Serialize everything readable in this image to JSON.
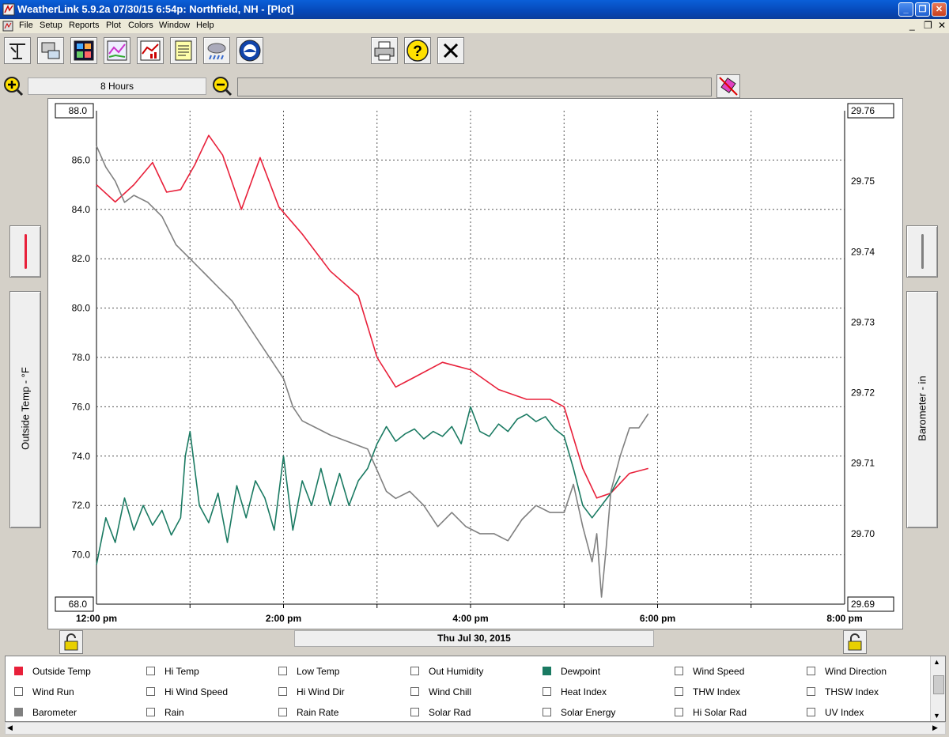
{
  "window": {
    "title": "WeatherLink 5.9.2a  07/30/15   6:54p: Northfield, NH - [Plot]"
  },
  "menu": [
    "File",
    "Setup",
    "Reports",
    "Plot",
    "Colors",
    "Window",
    "Help"
  ],
  "toolbar": {
    "icons": [
      "station-icon",
      "download-icon",
      "bulletin-icon",
      "strip-chart-icon",
      "plot-icon",
      "browse-icon",
      "forecast-icon",
      "noaa-icon",
      "print-icon",
      "help-icon",
      "close-icon"
    ]
  },
  "range": {
    "zoom_in": "+",
    "span": "8 Hours",
    "zoom_out": "−",
    "status": ""
  },
  "left_axis": {
    "label": "Outside Temp - °F",
    "ticks": [
      "88.0",
      "86.0",
      "84.0",
      "82.0",
      "80.0",
      "78.0",
      "76.0",
      "74.0",
      "72.0",
      "70.0",
      "68.0"
    ]
  },
  "right_axis": {
    "label": "Barometer - in",
    "ticks": [
      "29.76",
      "29.75",
      "29.74",
      "29.73",
      "29.72",
      "29.71",
      "29.70",
      "29.69"
    ]
  },
  "x_axis": {
    "ticks": [
      "12:00 pm",
      "2:00 pm",
      "4:00 pm",
      "6:00 pm",
      "8:00 pm"
    ],
    "date": "Thu Jul 30, 2015"
  },
  "legend": [
    {
      "label": "Outside Temp",
      "color": "#e8203a",
      "checked": true
    },
    {
      "label": "Hi Temp",
      "checked": false
    },
    {
      "label": "Low Temp",
      "checked": false
    },
    {
      "label": "Out Humidity",
      "checked": false
    },
    {
      "label": "Dewpoint",
      "color": "#1a7a62",
      "checked": true
    },
    {
      "label": "Wind Speed",
      "checked": false
    },
    {
      "label": "Wind Direction",
      "checked": false
    },
    {
      "label": "Wind Run",
      "checked": false
    },
    {
      "label": "Hi Wind Speed",
      "checked": false
    },
    {
      "label": "Hi Wind Dir",
      "checked": false
    },
    {
      "label": "Wind Chill",
      "checked": false
    },
    {
      "label": "Heat Index",
      "checked": false
    },
    {
      "label": "THW Index",
      "checked": false
    },
    {
      "label": "THSW Index",
      "checked": false
    },
    {
      "label": "Barometer",
      "color": "#808080",
      "checked": true
    },
    {
      "label": "Rain",
      "checked": false
    },
    {
      "label": "Rain Rate",
      "checked": false
    },
    {
      "label": "Solar Rad",
      "checked": false
    },
    {
      "label": "Solar Energy",
      "checked": false
    },
    {
      "label": "Hi Solar Rad",
      "checked": false
    },
    {
      "label": "UV Index",
      "checked": false
    }
  ],
  "chart_data": {
    "type": "line",
    "x_unit": "hours after 12:00 pm",
    "xlim": [
      0,
      8
    ],
    "ylim_left": [
      68,
      88
    ],
    "ylim_right": [
      29.69,
      29.76
    ],
    "grid": true,
    "series": [
      {
        "name": "Outside Temp",
        "axis": "left",
        "color": "#e8203a",
        "x": [
          0,
          0.2,
          0.4,
          0.6,
          0.75,
          0.9,
          1.05,
          1.2,
          1.35,
          1.55,
          1.75,
          1.95,
          2.2,
          2.5,
          2.8,
          3.0,
          3.2,
          3.4,
          3.7,
          4.0,
          4.3,
          4.6,
          4.85,
          5.0,
          5.2,
          5.35,
          5.5,
          5.7,
          5.9
        ],
        "y": [
          85.0,
          84.3,
          85.0,
          85.9,
          84.7,
          84.8,
          85.8,
          87.0,
          86.2,
          84.0,
          86.1,
          84.1,
          83.0,
          81.5,
          80.5,
          78.0,
          76.8,
          77.2,
          77.8,
          77.5,
          76.7,
          76.3,
          76.3,
          76.0,
          73.5,
          72.3,
          72.5,
          73.3,
          73.5
        ]
      },
      {
        "name": "Dewpoint",
        "axis": "left",
        "color": "#1a7a62",
        "x": [
          0,
          0.1,
          0.2,
          0.3,
          0.4,
          0.5,
          0.6,
          0.7,
          0.8,
          0.9,
          0.95,
          1.0,
          1.1,
          1.2,
          1.3,
          1.4,
          1.5,
          1.6,
          1.7,
          1.8,
          1.9,
          2.0,
          2.1,
          2.2,
          2.3,
          2.4,
          2.5,
          2.6,
          2.7,
          2.8,
          2.9,
          3.0,
          3.1,
          3.2,
          3.3,
          3.4,
          3.5,
          3.6,
          3.7,
          3.8,
          3.9,
          4.0,
          4.1,
          4.2,
          4.3,
          4.4,
          4.5,
          4.6,
          4.7,
          4.8,
          4.9,
          5.0,
          5.1,
          5.2,
          5.3,
          5.4,
          5.5,
          5.6
        ],
        "y": [
          69.6,
          71.5,
          70.5,
          72.3,
          71.0,
          72.0,
          71.2,
          71.8,
          70.8,
          71.5,
          74.0,
          75.0,
          72.0,
          71.3,
          72.5,
          70.5,
          72.8,
          71.5,
          73.0,
          72.3,
          71.0,
          74.0,
          71.0,
          73.0,
          72.0,
          73.5,
          72.0,
          73.3,
          72.0,
          73.0,
          73.5,
          74.5,
          75.2,
          74.6,
          74.9,
          75.1,
          74.7,
          75.0,
          74.8,
          75.2,
          74.5,
          76.0,
          75.0,
          74.8,
          75.3,
          75.0,
          75.5,
          75.7,
          75.4,
          75.6,
          75.1,
          74.8,
          73.5,
          72.0,
          71.5,
          72.0,
          72.5,
          73.2
        ]
      },
      {
        "name": "Barometer",
        "axis": "right",
        "color": "#808080",
        "x": [
          0,
          0.1,
          0.2,
          0.3,
          0.4,
          0.55,
          0.7,
          0.85,
          1.0,
          1.15,
          1.3,
          1.45,
          1.6,
          1.75,
          1.9,
          2.0,
          2.1,
          2.2,
          2.35,
          2.5,
          2.7,
          2.9,
          3.0,
          3.1,
          3.2,
          3.35,
          3.5,
          3.65,
          3.8,
          3.95,
          4.1,
          4.25,
          4.4,
          4.55,
          4.7,
          4.85,
          5.0,
          5.1,
          5.2,
          5.3,
          5.35,
          5.4,
          5.45,
          5.5,
          5.6,
          5.7,
          5.8,
          5.9
        ],
        "y": [
          29.755,
          29.752,
          29.75,
          29.747,
          29.748,
          29.747,
          29.745,
          29.741,
          29.739,
          29.737,
          29.735,
          29.733,
          29.73,
          29.727,
          29.724,
          29.722,
          29.718,
          29.716,
          29.715,
          29.714,
          29.713,
          29.712,
          29.709,
          29.706,
          29.705,
          29.706,
          29.704,
          29.701,
          29.703,
          29.701,
          29.7,
          29.7,
          29.699,
          29.702,
          29.704,
          29.703,
          29.703,
          29.707,
          29.701,
          29.696,
          29.7,
          29.691,
          29.698,
          29.706,
          29.711,
          29.715,
          29.715,
          29.717
        ]
      }
    ]
  }
}
